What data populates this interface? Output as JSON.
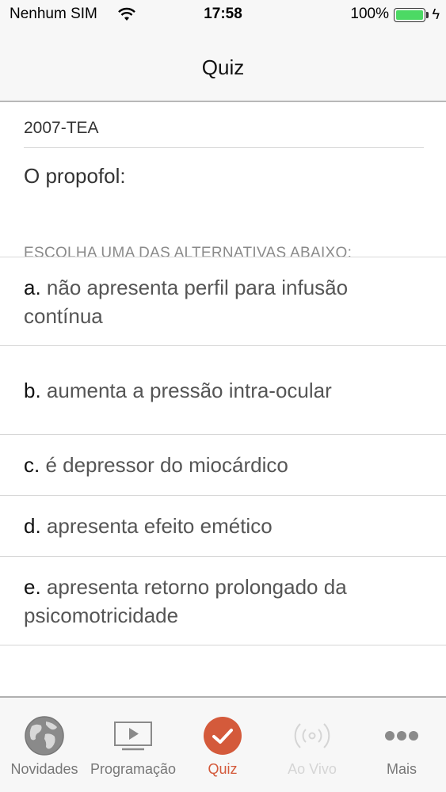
{
  "status": {
    "carrier": "Nenhum SIM",
    "time": "17:58",
    "battery": "100%",
    "battery_level": 1.0
  },
  "nav": {
    "title": "Quiz"
  },
  "quiz": {
    "source": "2007-TEA",
    "question": "O propofol:",
    "instruction": "ESCOLHA UMA DAS ALTERNATIVAS ABAIXO:",
    "options": [
      {
        "letter": "a.",
        "text": "não apresenta perfil para infusão contínua"
      },
      {
        "letter": "b.",
        "text": "aumenta a pressão intra-ocular"
      },
      {
        "letter": "c.",
        "text": "é depressor do miocárdico"
      },
      {
        "letter": "d.",
        "text": "apresenta efeito emético"
      },
      {
        "letter": "e.",
        "text": "apresenta retorno prolongado da psicomotricidade"
      }
    ]
  },
  "tabs": [
    {
      "label": "Novidades",
      "icon": "globe-icon"
    },
    {
      "label": "Programação",
      "icon": "play-screen-icon"
    },
    {
      "label": "Quiz",
      "icon": "checkmark-circle-icon",
      "active": true
    },
    {
      "label": "Ao Vivo",
      "icon": "broadcast-icon",
      "disabled": true
    },
    {
      "label": "Mais",
      "icon": "more-dots-icon"
    }
  ],
  "colors": {
    "accent": "#d45a3b",
    "battery": "#4cd964"
  }
}
